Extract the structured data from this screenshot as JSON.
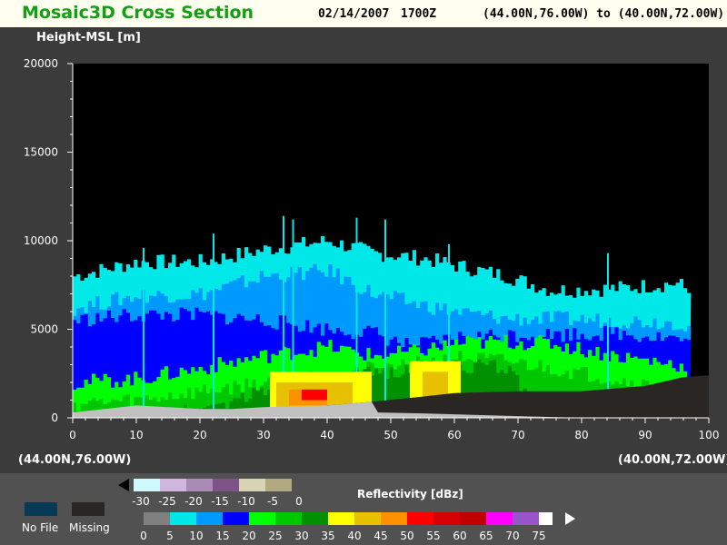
{
  "header": {
    "title": "Mosaic3D Cross Section",
    "date": "02/14/2007",
    "time": "1700Z",
    "route": "(44.00N,76.00W) to (40.00N,72.00W)"
  },
  "axis": {
    "ylabel": "Height-MSL [m]",
    "start_point": "(44.00N,76.00W)",
    "end_point": "(40.00N,72.00W)"
  },
  "legend": {
    "title": "Reflectivity [dBz]",
    "no_file_label": "No File",
    "missing_label": "Missing",
    "no_file_color": "#063a55",
    "missing_color": "#2a2624",
    "low_scale": {
      "colors": [
        "#000000",
        "#cff8ff",
        "#d2b6dd",
        "#a98bb5",
        "#7e5388",
        "#d8d3b2",
        "#b0a981"
      ],
      "labels": [
        "-30",
        "-25",
        "-20",
        "-15",
        "-10",
        "-5",
        "0"
      ]
    },
    "high_scale": {
      "colors": [
        "#808080",
        "#00e8e8",
        "#009aff",
        "#0000ff",
        "#00ff00",
        "#00c800",
        "#009000",
        "#ffff00",
        "#e7c000",
        "#ff9000",
        "#ff0000",
        "#d60000",
        "#c00000",
        "#ff00ff",
        "#9955c9",
        "#ffffff"
      ],
      "labels": [
        "0",
        "5",
        "10",
        "15",
        "20",
        "25",
        "30",
        "35",
        "40",
        "45",
        "50",
        "55",
        "60",
        "65",
        "70",
        "75"
      ]
    }
  },
  "chart_data": {
    "type": "heatmap",
    "title": "Mosaic3D Cross Section",
    "xlabel": "",
    "ylabel": "Height-MSL [m]",
    "xlim": [
      0,
      100
    ],
    "ylim": [
      0,
      20000
    ],
    "x_ticks": [
      0,
      10,
      20,
      30,
      40,
      50,
      60,
      70,
      80,
      90,
      100
    ],
    "y_ticks": [
      0,
      5000,
      10000,
      15000,
      20000
    ],
    "y_tick_labels": [
      "0",
      "5000",
      "10000",
      "15000",
      "20000"
    ],
    "x_tick_labels": [
      "0",
      "10",
      "20",
      "30",
      "40",
      "50",
      "60",
      "70",
      "80",
      "90",
      "100"
    ],
    "value_units": "dBz",
    "bands": [
      {
        "dbz": 5,
        "color": "#00e8e8",
        "profile": [
          [
            0,
            8000
          ],
          [
            10,
            8800
          ],
          [
            20,
            8800
          ],
          [
            30,
            9500
          ],
          [
            40,
            10000
          ],
          [
            47,
            9300
          ],
          [
            55,
            9000
          ],
          [
            60,
            8600
          ],
          [
            68,
            8000
          ],
          [
            75,
            7200
          ],
          [
            85,
            7300
          ],
          [
            95,
            7600
          ],
          [
            97,
            7000
          ]
        ]
      },
      {
        "dbz": 10,
        "color": "#009aff",
        "profile": [
          [
            0,
            6200
          ],
          [
            10,
            6900
          ],
          [
            20,
            7000
          ],
          [
            30,
            8000
          ],
          [
            40,
            8300
          ],
          [
            47,
            7000
          ],
          [
            53,
            6500
          ],
          [
            60,
            6000
          ],
          [
            68,
            5600
          ],
          [
            75,
            5600
          ],
          [
            85,
            5500
          ],
          [
            95,
            5400
          ],
          [
            97,
            5000
          ]
        ]
      },
      {
        "dbz": 15,
        "color": "#0000ff",
        "profile": [
          [
            0,
            5500
          ],
          [
            10,
            5800
          ],
          [
            20,
            5800
          ],
          [
            30,
            5500
          ],
          [
            40,
            5000
          ],
          [
            47,
            4800
          ],
          [
            53,
            4000
          ],
          [
            60,
            4500
          ],
          [
            68,
            4700
          ],
          [
            75,
            4700
          ],
          [
            85,
            4800
          ],
          [
            95,
            4500
          ],
          [
            97,
            4000
          ]
        ]
      },
      {
        "dbz": 20,
        "color": "#00ff00",
        "profile": [
          [
            0,
            2000
          ],
          [
            10,
            2200
          ],
          [
            20,
            2800
          ],
          [
            30,
            3500
          ],
          [
            40,
            4000
          ],
          [
            47,
            3500
          ],
          [
            53,
            3700
          ],
          [
            60,
            4200
          ],
          [
            68,
            4300
          ],
          [
            75,
            4200
          ],
          [
            85,
            3500
          ],
          [
            95,
            3000
          ],
          [
            97,
            2500
          ]
        ]
      },
      {
        "dbz": 25,
        "color": "#00c800",
        "profile": [
          [
            0,
            800
          ],
          [
            10,
            1000
          ],
          [
            20,
            1500
          ],
          [
            30,
            2000
          ],
          [
            40,
            2500
          ],
          [
            47,
            2800
          ],
          [
            53,
            3000
          ],
          [
            60,
            3400
          ],
          [
            68,
            3200
          ],
          [
            75,
            2800
          ],
          [
            85,
            2200
          ],
          [
            95,
            1500
          ],
          [
            97,
            1000
          ]
        ]
      },
      {
        "dbz": 30,
        "color": "#009000",
        "profile": [
          [
            0,
            0
          ],
          [
            10,
            0
          ],
          [
            20,
            500
          ],
          [
            30,
            1500
          ],
          [
            40,
            2000
          ],
          [
            47,
            2500
          ],
          [
            53,
            2800
          ],
          [
            60,
            3000
          ],
          [
            68,
            2800
          ],
          [
            75,
            0
          ],
          [
            85,
            0
          ],
          [
            95,
            0
          ],
          [
            97,
            0
          ]
        ]
      }
    ],
    "cells": [
      {
        "dbz": 35,
        "color": "#ffff00",
        "x": [
          31,
          47
        ],
        "y": [
          400,
          2600
        ]
      },
      {
        "dbz": 40,
        "color": "#e7c000",
        "x": [
          32,
          44
        ],
        "y": [
          600,
          2000
        ]
      },
      {
        "dbz": 45,
        "color": "#ff9000",
        "x": [
          34,
          40
        ],
        "y": [
          700,
          1600
        ]
      },
      {
        "dbz": 50,
        "color": "#ff0000",
        "x": [
          36,
          40
        ],
        "y": [
          1000,
          1600
        ]
      },
      {
        "dbz": 35,
        "color": "#ffff00",
        "x": [
          53,
          61
        ],
        "y": [
          400,
          3200
        ]
      },
      {
        "dbz": 40,
        "color": "#e7c000",
        "x": [
          55,
          59
        ],
        "y": [
          700,
          2600
        ]
      }
    ],
    "spikes": [
      {
        "x": 11,
        "top": 9600
      },
      {
        "x": 22,
        "top": 10400
      },
      {
        "x": 33,
        "top": 11400
      },
      {
        "x": 34.5,
        "top": 11200
      },
      {
        "x": 44.5,
        "top": 11300
      },
      {
        "x": 49,
        "top": 11200
      },
      {
        "x": 59,
        "top": 9800
      },
      {
        "x": 84,
        "top": 9300
      }
    ],
    "terrain_profile": [
      [
        0,
        300
      ],
      [
        5,
        500
      ],
      [
        10,
        700
      ],
      [
        15,
        600
      ],
      [
        20,
        500
      ],
      [
        25,
        500
      ],
      [
        30,
        600
      ],
      [
        40,
        700
      ],
      [
        47,
        900
      ],
      [
        48,
        300
      ],
      [
        55,
        250
      ],
      [
        60,
        200
      ],
      [
        70,
        100
      ],
      [
        80,
        0
      ],
      [
        90,
        0
      ],
      [
        100,
        0
      ]
    ],
    "missing_profile": [
      [
        0,
        200
      ],
      [
        10,
        300
      ],
      [
        20,
        400
      ],
      [
        25,
        500
      ],
      [
        30,
        500
      ],
      [
        35,
        600
      ],
      [
        40,
        700
      ],
      [
        47,
        900
      ],
      [
        55,
        1200
      ],
      [
        60,
        1400
      ],
      [
        70,
        1500
      ],
      [
        80,
        1500
      ],
      [
        90,
        1800
      ],
      [
        96,
        2300
      ],
      [
        100,
        2400
      ]
    ]
  }
}
